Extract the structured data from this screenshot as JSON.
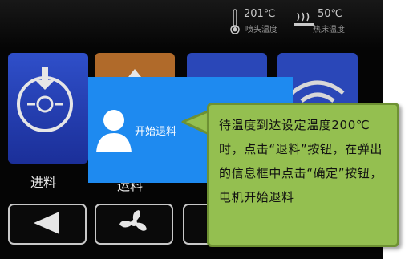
{
  "status": {
    "nozzle_temp": "201℃",
    "nozzle_label": "喷头温度",
    "bed_temp": "50℃",
    "bed_label": "热床温度"
  },
  "tiles": {
    "load_label": "进料",
    "move_label": "运料"
  },
  "dialog": {
    "message": "开始退料"
  },
  "callout": {
    "text": "待温度到达设定温度200℃时，点击“退料”按钮，在弹出的信息框中点击“确定”按钮，电机开始退料"
  },
  "colors": {
    "dialog_bg": "#1e8af0",
    "callout_bg": "#94bf50",
    "tile_blue": "#2f4fc9",
    "tile_orange": "#b06a2a"
  }
}
